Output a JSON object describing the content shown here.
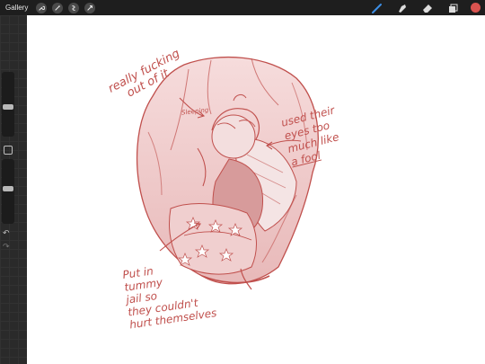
{
  "topbar": {
    "gallery_label": "Gallery",
    "tools_left": [
      "wrench-icon",
      "wand-icon",
      "selection-icon",
      "transform-icon"
    ],
    "tools_right": [
      "brush-icon",
      "smudge-icon",
      "eraser-icon",
      "layers-icon"
    ],
    "active_color": "#d9534f",
    "brush_color": "#3d8fe6"
  },
  "sidebar": {
    "brush_size": 0.45,
    "opacity": 0.55,
    "icons": [
      "modify-button",
      "undo-icon",
      "redo-icon"
    ]
  },
  "canvas": {
    "ink_color": "#c0504d",
    "annotations": {
      "top_left": [
        "really fucking",
        "out of it"
      ],
      "right": [
        "used their",
        "eyes too",
        "much like",
        "a fool"
      ],
      "bottom_left": [
        "Put in",
        "tummy",
        "jail so",
        "they couldn't",
        "hurt themselves"
      ],
      "small_label": "Sleeping"
    }
  }
}
